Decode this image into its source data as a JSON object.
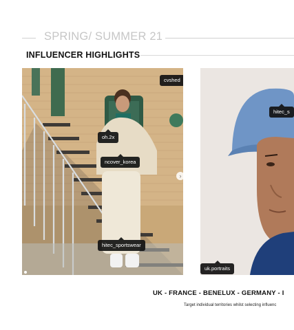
{
  "header": {
    "season": "SPRING/ SUMMER 21",
    "section_title": "INFLUENCER HIGHLIGHTS"
  },
  "photos": [
    {
      "tags": [
        "cvshed",
        "oh.2x",
        "ncover_korea",
        "hitec_sportswear"
      ]
    },
    {
      "tags": [
        "hitec_s",
        "uk.portraits"
      ]
    }
  ],
  "carousel": {
    "next_icon": "chevron-right-icon",
    "next_glyph": "›"
  },
  "territories": {
    "items": [
      "UK -",
      "FRANCE -",
      "BENELUX -",
      "GERMANY",
      "- I"
    ],
    "note": "Target individual territories whilst selecting influenc"
  }
}
